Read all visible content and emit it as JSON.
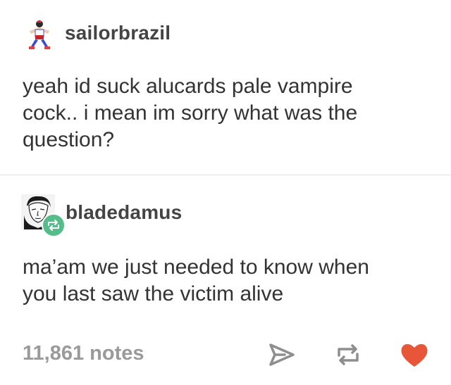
{
  "posts": [
    {
      "username": "sailorbrazil",
      "avatar_icon": "fighter-sprite-icon",
      "text_lines": [
        "yeah id suck alucards pale vampire",
        "cock.. i mean im sorry what was the",
        "question?"
      ]
    },
    {
      "username": "bladedamus",
      "avatar_icon": "sketch-portrait-icon",
      "badge_icon": "reblog-badge-icon",
      "text_lines": [
        "ma’am we just needed to know when",
        "you last saw the victim alive"
      ]
    }
  ],
  "footer": {
    "notes": "11,861 notes",
    "actions": [
      "share-icon",
      "reblog-icon",
      "heart-icon"
    ]
  },
  "colors": {
    "heart": "#e8563a",
    "badge": "#56bc8a",
    "notes": "#9a9a9a"
  }
}
